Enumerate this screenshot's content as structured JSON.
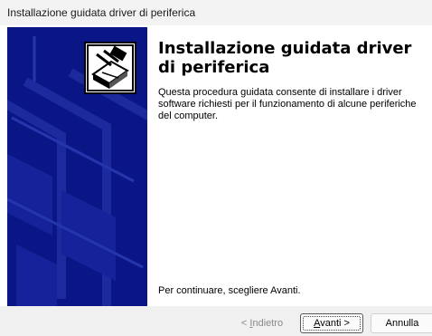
{
  "window": {
    "title": "Installazione guidata driver di periferica"
  },
  "content": {
    "heading": "Installazione guidata driver di periferica",
    "description": "Questa procedura guidata consente di installare i driver software richiesti per il funzionamento di alcune periferiche del computer.",
    "continue_text": "Per continuare, scegliere Avanti."
  },
  "buttons": {
    "back": {
      "prefix": "< ",
      "accel": "I",
      "rest": "ndietro"
    },
    "next": {
      "accel": "A",
      "rest": "vanti >"
    },
    "cancel": "Annulla"
  },
  "colors": {
    "banner": "#0b1686",
    "titlebar": "#f3f3f3",
    "footer": "#f0f0f0"
  },
  "icons": {
    "wizard": "hardware-install-icon"
  }
}
